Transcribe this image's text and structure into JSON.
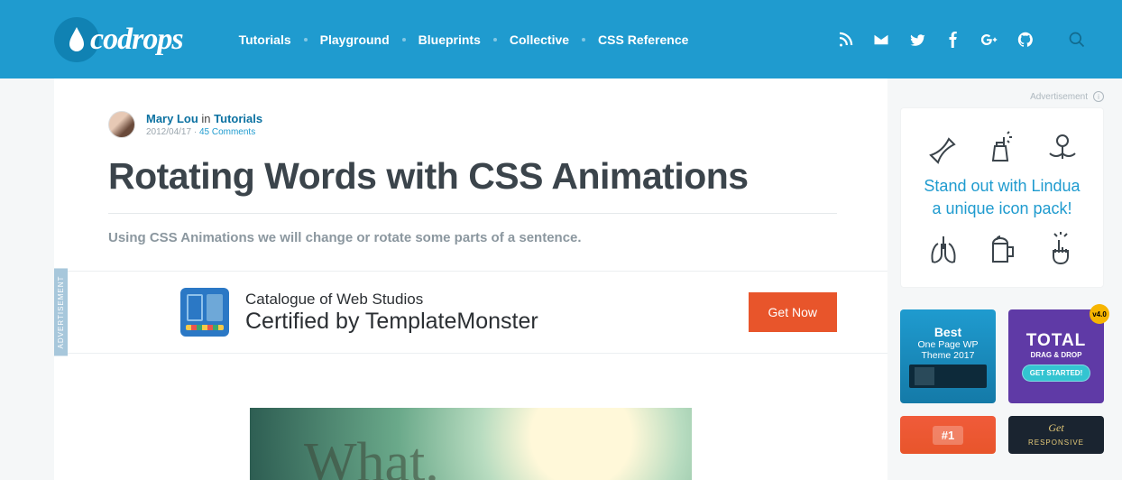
{
  "brand": "codrops",
  "nav": [
    "Tutorials",
    "Playground",
    "Blueprints",
    "Collective",
    "CSS Reference"
  ],
  "article": {
    "author": "Mary Lou",
    "in": "in",
    "category": "Tutorials",
    "date": "2012/04/17",
    "comments": "45 Comments",
    "title": "Rotating Words with CSS Animations",
    "intro": "Using CSS Animations we will change or rotate some parts of a sentence."
  },
  "inline_ad": {
    "label": "ADVERTISEMENT",
    "line1": "Catalogue of Web Studios",
    "line2": "Certified by TemplateMonster",
    "cta": "Get Now"
  },
  "hero_word": "What.",
  "sidebar": {
    "ad_label": "Advertisement",
    "promo_line1": "Stand out with Lindua",
    "promo_line2": "a unique icon pack!",
    "card_blue": {
      "l1": "Best",
      "l2": "One Page WP",
      "l3": "Theme 2017"
    },
    "card_purple": {
      "big": "TOTAL",
      "sub": "DRAG & DROP",
      "cta": "GET STARTED!",
      "badge": "v4.0"
    },
    "card_red": "#1",
    "card_dark_l1": "Get",
    "card_dark_l2": "RESPONSIVE"
  }
}
